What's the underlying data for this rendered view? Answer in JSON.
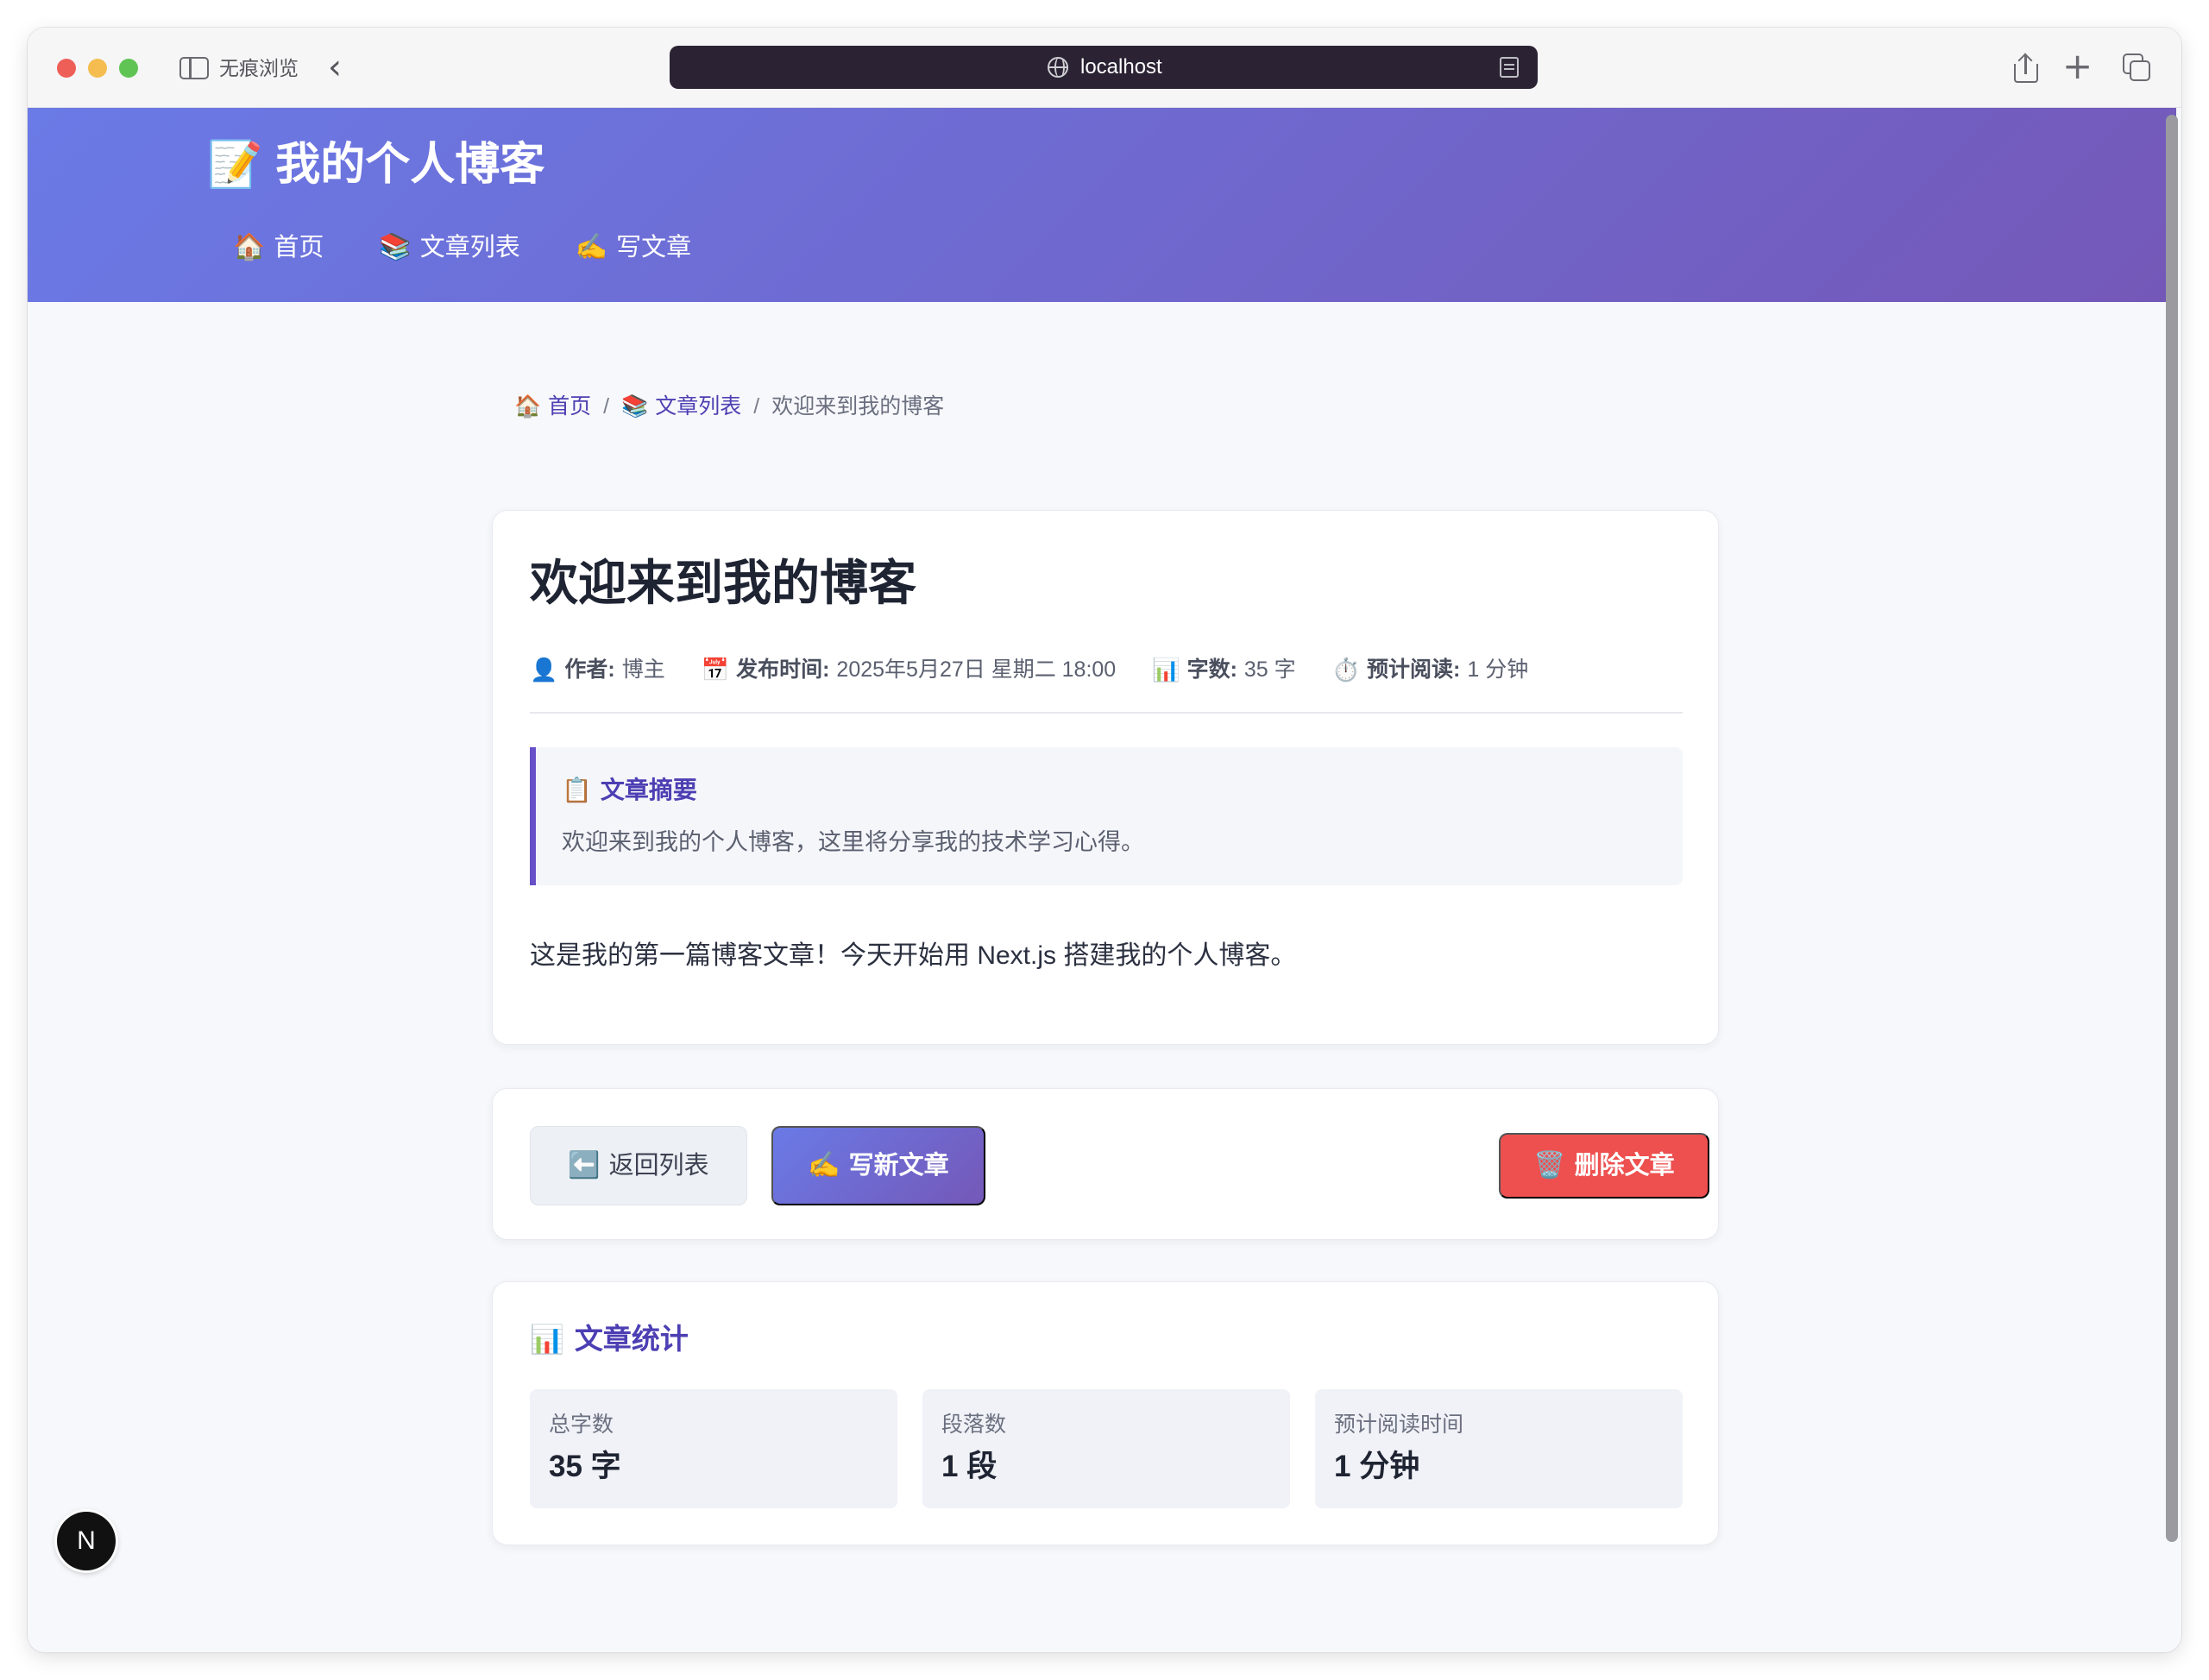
{
  "browser": {
    "private_label": "无痕浏览",
    "url": "localhost"
  },
  "site": {
    "title": "📝 我的个人博客",
    "nav": [
      {
        "icon": "🏠",
        "label": "首页"
      },
      {
        "icon": "📚",
        "label": "文章列表"
      },
      {
        "icon": "✍️",
        "label": "写文章"
      }
    ]
  },
  "breadcrumb": {
    "home_icon": "🏠",
    "home": "首页",
    "list_icon": "📚",
    "list": "文章列表",
    "separator": "/",
    "current": "欢迎来到我的博客"
  },
  "article": {
    "title": "欢迎来到我的博客",
    "meta": [
      {
        "icon": "👤",
        "label": "作者:",
        "value": "博主"
      },
      {
        "icon": "📅",
        "label": "发布时间:",
        "value": "2025年5月27日 星期二 18:00"
      },
      {
        "icon": "📊",
        "label": "字数:",
        "value": "35 字"
      },
      {
        "icon": "⏱️",
        "label": "预计阅读:",
        "value": "1 分钟"
      }
    ],
    "summary_icon": "📋",
    "summary_title": "文章摘要",
    "summary_text": "欢迎来到我的个人博客，这里将分享我的技术学习心得。",
    "body": "这是我的第一篇博客文章！今天开始用 Next.js 搭建我的个人博客。"
  },
  "actions": {
    "back_icon": "⬅️",
    "back": "返回列表",
    "write_icon": "✍️",
    "write": "写新文章",
    "delete_icon": "🗑️",
    "delete": "删除文章"
  },
  "stats": {
    "title_icon": "📊",
    "title": "文章统计",
    "items": [
      {
        "label": "总字数",
        "value": "35 字"
      },
      {
        "label": "段落数",
        "value": "1 段"
      },
      {
        "label": "预计阅读时间",
        "value": "1 分钟"
      }
    ]
  },
  "dev_badge": "N",
  "colors": {
    "header_gradient_start": "#6a7ae6",
    "header_gradient_end": "#7458b8",
    "accent": "#4c3fb3",
    "delete": "#ee4f4f"
  }
}
